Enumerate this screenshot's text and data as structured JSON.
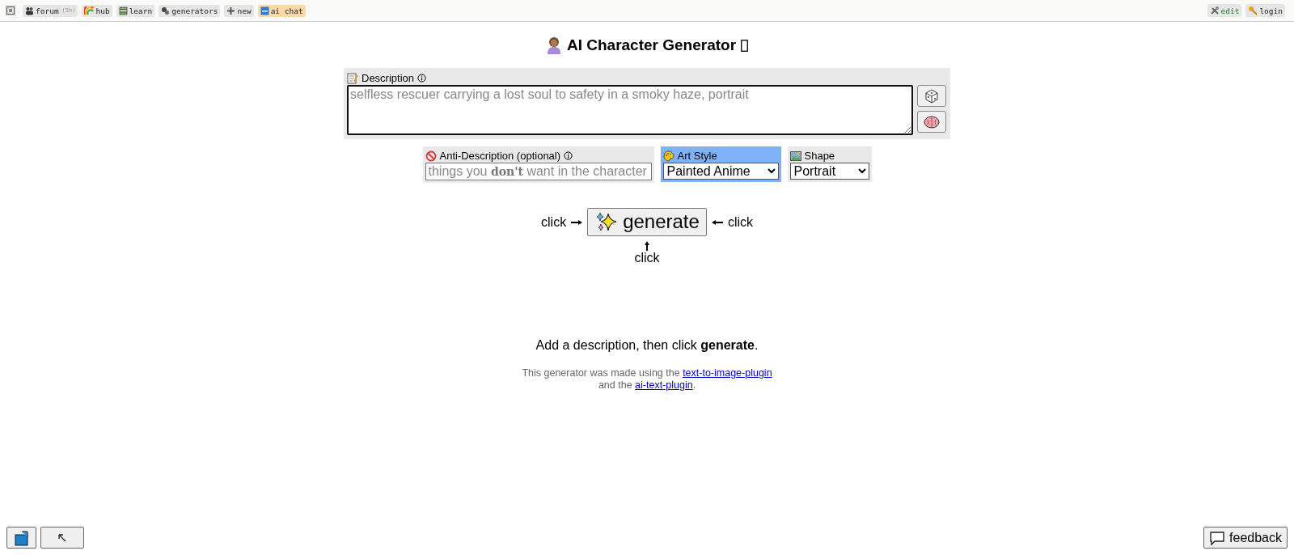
{
  "nav": {
    "items": [
      {
        "label": "forum",
        "note": "(5h)",
        "selected": false
      },
      {
        "label": "hub",
        "selected": false
      },
      {
        "label": "learn",
        "selected": false
      },
      {
        "label": "generators",
        "selected": false
      },
      {
        "label": "new",
        "selected": false
      },
      {
        "label": "ai chat",
        "selected": true
      }
    ],
    "right_items": [
      {
        "label": "edit"
      },
      {
        "label": "login"
      }
    ]
  },
  "title": "AI Character Generator",
  "description": {
    "label": "Description",
    "placeholder": "selfless rescuer carrying a lost soul to safety in a smoky haze, portrait"
  },
  "options": [
    {
      "kind": "text",
      "label": "Anti-Description (optional)",
      "placeholder": "things you **don't** want in the character",
      "highlighted": false
    },
    {
      "kind": "select",
      "label": "Art Style",
      "value": "Painted Anime",
      "highlighted": true
    },
    {
      "kind": "select",
      "label": "Shape",
      "value": "Portrait",
      "highlighted": false
    }
  ],
  "generate": {
    "button": "generate",
    "hint_left": "click",
    "hint_right": "click",
    "hint_below": "click"
  },
  "message": "Add a description, then click **generate**.",
  "credits": {
    "before": "This generator was made using the",
    "link_1": "text-to-image-plugin",
    "middle": "and the",
    "link_2": "ai-text-plugin",
    "after": "."
  },
  "feedback": "feedback"
}
